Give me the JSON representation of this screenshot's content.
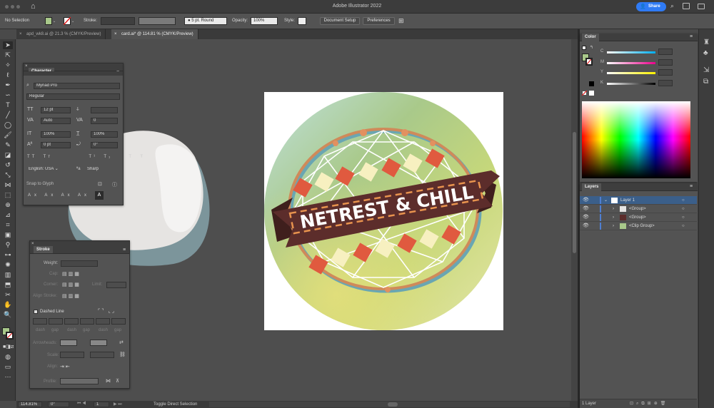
{
  "app": {
    "title": "Adobe Illustrator 2022",
    "share_label": "Share"
  },
  "control_bar": {
    "selection": "No Selection",
    "stroke_label": "Stroke:",
    "brush": "5 pt. Round",
    "opacity_label": "Opacity:",
    "opacity_value": "100%",
    "style_label": "Style:",
    "document_setup": "Document Setup",
    "preferences": "Preferences"
  },
  "tabs": [
    {
      "label": "apd_wk8.ai @ 21.3 % (CMYK/Preview)"
    },
    {
      "label": "card.ai* @ 114.81 % (CMYK/Preview)"
    }
  ],
  "artwork": {
    "banner_text": "NETREST & CHILL"
  },
  "character_panel": {
    "title": "Character",
    "font_family": "Myriad Pro",
    "font_style": "Regular",
    "font_size": "12 pt",
    "leading": "Auto",
    "kerning": "0",
    "vertical_scale": "100%",
    "horizontal_scale": "100%",
    "baseline_shift": "0 pt",
    "rotation": "0°",
    "language": "English: USA",
    "antialias": "Sharp",
    "snap_to_glyph": "Snap to Glyph"
  },
  "stroke_panel": {
    "title": "Stroke",
    "weight_label": "Weight:",
    "cap_label": "Cap:",
    "corner_label": "Corner:",
    "limit_label": "Limit:",
    "align_stroke_label": "Align Stroke:",
    "dashed_line_label": "Dashed Line",
    "dash_gap_labels": [
      "dash",
      "gap",
      "dash",
      "gap",
      "dash",
      "gap"
    ],
    "arrowheads_label": "Arrowheads:",
    "scale_label": "Scale:",
    "align_label": "Align:",
    "profile_label": "Profile:"
  },
  "color_panel": {
    "title": "Color",
    "channels": [
      "C",
      "M",
      "Y",
      "K"
    ]
  },
  "layers_panel": {
    "title": "Layers",
    "rows": [
      {
        "name": "Layer 1"
      },
      {
        "name": "<Group>"
      },
      {
        "name": "<Group>"
      },
      {
        "name": "<Clip Group>"
      }
    ],
    "footer": "1 Layer"
  },
  "status_bar": {
    "zoom": "114.81%",
    "rotate": "0°",
    "artboard": "1",
    "tool_hint": "Toggle Direct Selection"
  },
  "colors": {
    "app_bg": "#4a4a4a",
    "panel_bg": "#535353",
    "accent": "#2f7bf5",
    "banner": "#5c2d2b",
    "diamond_red": "#e05a3f",
    "diamond_cream": "#f7f0c0",
    "string_color": "#ffffff"
  }
}
